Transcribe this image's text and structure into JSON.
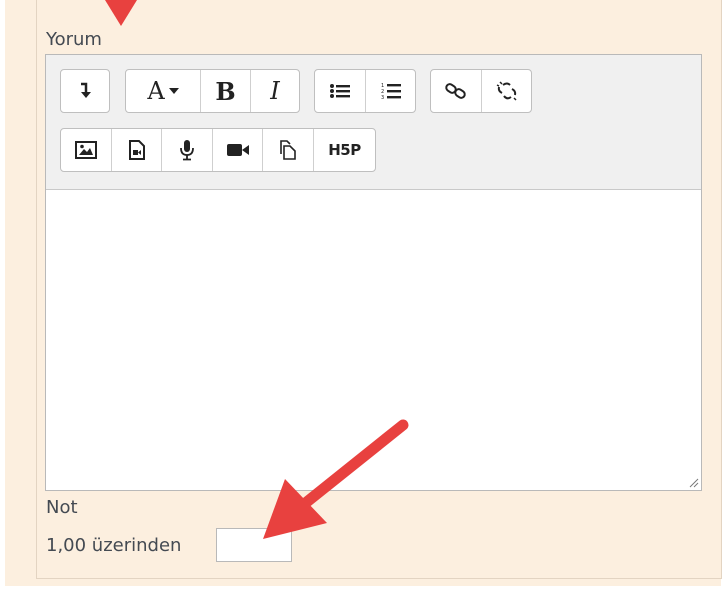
{
  "form": {
    "comment_label": "Yorum",
    "grade_label": "Not",
    "out_of_text": "1,00 üzerinden",
    "grade_value": ""
  },
  "toolbar": {
    "row1": [
      {
        "name": "collapse-toolbar-button",
        "icon": "arrow-down-icon",
        "glyph": "↴"
      },
      {
        "name": "font-style-button",
        "icon": "font-icon",
        "glyph": "A▾"
      },
      {
        "name": "bold-button",
        "icon": "bold-icon",
        "glyph": "B"
      },
      {
        "name": "italic-button",
        "icon": "italic-icon",
        "glyph": "I"
      },
      {
        "name": "unordered-list-button",
        "icon": "list-ul-icon",
        "glyph": "≡"
      },
      {
        "name": "ordered-list-button",
        "icon": "list-ol-icon",
        "glyph": "≡"
      },
      {
        "name": "link-button",
        "icon": "link-icon",
        "glyph": "⛓"
      },
      {
        "name": "unlink-button",
        "icon": "unlink-icon",
        "glyph": "⛓"
      }
    ],
    "row2": [
      {
        "name": "insert-image-button",
        "icon": "image-icon"
      },
      {
        "name": "insert-media-button",
        "icon": "file-video-icon"
      },
      {
        "name": "record-audio-button",
        "icon": "microphone-icon"
      },
      {
        "name": "record-video-button",
        "icon": "video-camera-icon"
      },
      {
        "name": "manage-files-button",
        "icon": "copy-files-icon"
      },
      {
        "name": "h5p-button",
        "icon": "h5p-icon",
        "text": "H5P"
      }
    ]
  },
  "colors": {
    "panel_bg": "#fcefdf",
    "arrow_red": "#e8413f",
    "toolbar_bg": "#f0f0f0"
  }
}
